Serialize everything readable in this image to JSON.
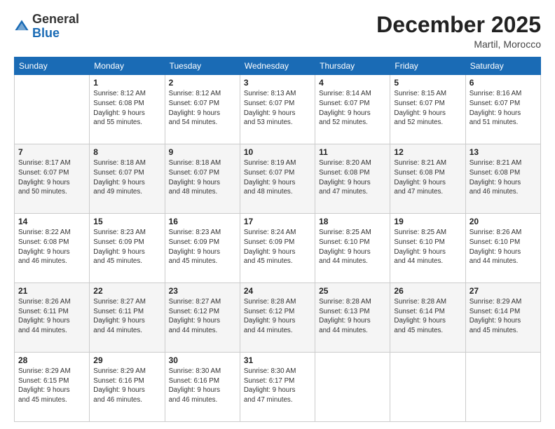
{
  "header": {
    "logo_general": "General",
    "logo_blue": "Blue",
    "month_title": "December 2025",
    "location": "Martil, Morocco"
  },
  "columns": [
    "Sunday",
    "Monday",
    "Tuesday",
    "Wednesday",
    "Thursday",
    "Friday",
    "Saturday"
  ],
  "weeks": [
    [
      {
        "day": "",
        "info": ""
      },
      {
        "day": "1",
        "info": "Sunrise: 8:12 AM\nSunset: 6:08 PM\nDaylight: 9 hours\nand 55 minutes."
      },
      {
        "day": "2",
        "info": "Sunrise: 8:12 AM\nSunset: 6:07 PM\nDaylight: 9 hours\nand 54 minutes."
      },
      {
        "day": "3",
        "info": "Sunrise: 8:13 AM\nSunset: 6:07 PM\nDaylight: 9 hours\nand 53 minutes."
      },
      {
        "day": "4",
        "info": "Sunrise: 8:14 AM\nSunset: 6:07 PM\nDaylight: 9 hours\nand 52 minutes."
      },
      {
        "day": "5",
        "info": "Sunrise: 8:15 AM\nSunset: 6:07 PM\nDaylight: 9 hours\nand 52 minutes."
      },
      {
        "day": "6",
        "info": "Sunrise: 8:16 AM\nSunset: 6:07 PM\nDaylight: 9 hours\nand 51 minutes."
      }
    ],
    [
      {
        "day": "7",
        "info": "Sunrise: 8:17 AM\nSunset: 6:07 PM\nDaylight: 9 hours\nand 50 minutes."
      },
      {
        "day": "8",
        "info": "Sunrise: 8:18 AM\nSunset: 6:07 PM\nDaylight: 9 hours\nand 49 minutes."
      },
      {
        "day": "9",
        "info": "Sunrise: 8:18 AM\nSunset: 6:07 PM\nDaylight: 9 hours\nand 48 minutes."
      },
      {
        "day": "10",
        "info": "Sunrise: 8:19 AM\nSunset: 6:07 PM\nDaylight: 9 hours\nand 48 minutes."
      },
      {
        "day": "11",
        "info": "Sunrise: 8:20 AM\nSunset: 6:08 PM\nDaylight: 9 hours\nand 47 minutes."
      },
      {
        "day": "12",
        "info": "Sunrise: 8:21 AM\nSunset: 6:08 PM\nDaylight: 9 hours\nand 47 minutes."
      },
      {
        "day": "13",
        "info": "Sunrise: 8:21 AM\nSunset: 6:08 PM\nDaylight: 9 hours\nand 46 minutes."
      }
    ],
    [
      {
        "day": "14",
        "info": "Sunrise: 8:22 AM\nSunset: 6:08 PM\nDaylight: 9 hours\nand 46 minutes."
      },
      {
        "day": "15",
        "info": "Sunrise: 8:23 AM\nSunset: 6:09 PM\nDaylight: 9 hours\nand 45 minutes."
      },
      {
        "day": "16",
        "info": "Sunrise: 8:23 AM\nSunset: 6:09 PM\nDaylight: 9 hours\nand 45 minutes."
      },
      {
        "day": "17",
        "info": "Sunrise: 8:24 AM\nSunset: 6:09 PM\nDaylight: 9 hours\nand 45 minutes."
      },
      {
        "day": "18",
        "info": "Sunrise: 8:25 AM\nSunset: 6:10 PM\nDaylight: 9 hours\nand 44 minutes."
      },
      {
        "day": "19",
        "info": "Sunrise: 8:25 AM\nSunset: 6:10 PM\nDaylight: 9 hours\nand 44 minutes."
      },
      {
        "day": "20",
        "info": "Sunrise: 8:26 AM\nSunset: 6:10 PM\nDaylight: 9 hours\nand 44 minutes."
      }
    ],
    [
      {
        "day": "21",
        "info": "Sunrise: 8:26 AM\nSunset: 6:11 PM\nDaylight: 9 hours\nand 44 minutes."
      },
      {
        "day": "22",
        "info": "Sunrise: 8:27 AM\nSunset: 6:11 PM\nDaylight: 9 hours\nand 44 minutes."
      },
      {
        "day": "23",
        "info": "Sunrise: 8:27 AM\nSunset: 6:12 PM\nDaylight: 9 hours\nand 44 minutes."
      },
      {
        "day": "24",
        "info": "Sunrise: 8:28 AM\nSunset: 6:12 PM\nDaylight: 9 hours\nand 44 minutes."
      },
      {
        "day": "25",
        "info": "Sunrise: 8:28 AM\nSunset: 6:13 PM\nDaylight: 9 hours\nand 44 minutes."
      },
      {
        "day": "26",
        "info": "Sunrise: 8:28 AM\nSunset: 6:14 PM\nDaylight: 9 hours\nand 45 minutes."
      },
      {
        "day": "27",
        "info": "Sunrise: 8:29 AM\nSunset: 6:14 PM\nDaylight: 9 hours\nand 45 minutes."
      }
    ],
    [
      {
        "day": "28",
        "info": "Sunrise: 8:29 AM\nSunset: 6:15 PM\nDaylight: 9 hours\nand 45 minutes."
      },
      {
        "day": "29",
        "info": "Sunrise: 8:29 AM\nSunset: 6:16 PM\nDaylight: 9 hours\nand 46 minutes."
      },
      {
        "day": "30",
        "info": "Sunrise: 8:30 AM\nSunset: 6:16 PM\nDaylight: 9 hours\nand 46 minutes."
      },
      {
        "day": "31",
        "info": "Sunrise: 8:30 AM\nSunset: 6:17 PM\nDaylight: 9 hours\nand 47 minutes."
      },
      {
        "day": "",
        "info": ""
      },
      {
        "day": "",
        "info": ""
      },
      {
        "day": "",
        "info": ""
      }
    ]
  ]
}
